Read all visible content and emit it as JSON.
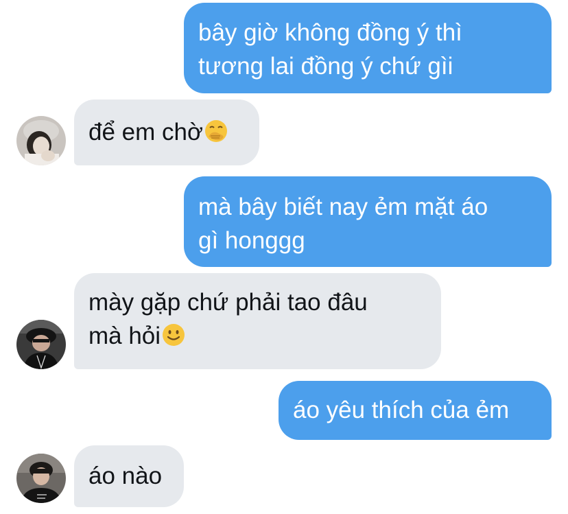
{
  "conversation": {
    "messages": [
      {
        "sender": "me",
        "lines": [
          "bây giờ không đồng ý thì",
          "tương lai đồng ý chứ gìi"
        ]
      },
      {
        "sender": "them",
        "text": "để em chờ",
        "emoji": "hand-over-mouth-emoji"
      },
      {
        "sender": "me",
        "lines": [
          "mà bây biết nay ẻm mặt áo",
          "gì honggg"
        ]
      },
      {
        "sender": "them",
        "line1": "mày gặp chứ phải tao đâu",
        "line2": "mà hỏi",
        "emoji": "slightly-smiling-emoji"
      },
      {
        "sender": "me",
        "text": "áo yêu thích của ẻm"
      },
      {
        "sender": "them",
        "text": "áo nào"
      }
    ]
  },
  "colors": {
    "outgoing_bubble": "#4c9fec",
    "incoming_bubble": "#e6e9ed",
    "outgoing_text": "#ffffff",
    "incoming_text": "#111418"
  }
}
